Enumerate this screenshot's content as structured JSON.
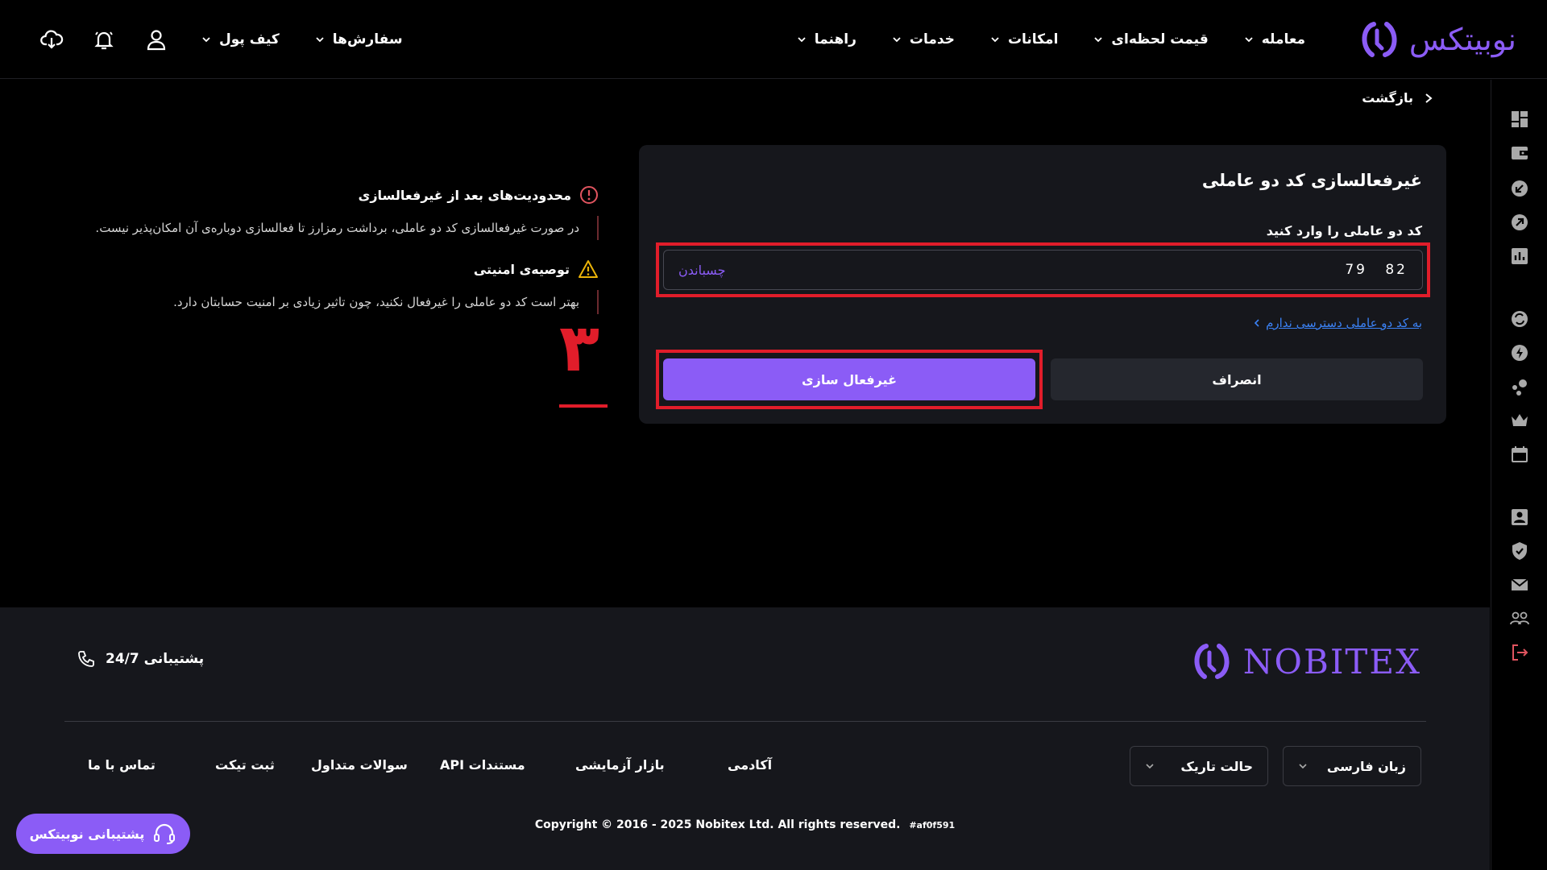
{
  "header": {
    "logo_text": "نوبیتکس",
    "nav": [
      {
        "label": "معامله"
      },
      {
        "label": "قیمت لحظه‌ای"
      },
      {
        "label": "امکانات"
      },
      {
        "label": "خدمات"
      },
      {
        "label": "راهنما"
      }
    ],
    "orders_label": "سفارش‌ها",
    "wallet_label": "کیف پول"
  },
  "back_label": "بازگشت",
  "card": {
    "title": "غیرفعالسازی کد دو عاملی",
    "field_label": "کد دو عاملی را وارد کنید",
    "code_value": "79  82",
    "paste_label": "چسباندن",
    "no_access_link": "به کد دو عاملی دسترسی ندارم",
    "cancel_label": "انصراف",
    "deactivate_label": "غیرفعال سازی"
  },
  "notes": {
    "restriction_title": "محدودیت‌های بعد از غیرفعالسازی",
    "restriction_body": "در صورت غیرفعالسازی کد دو عاملی، برداشت رمزارز تا فعالسازی دوباره‌ی آن امکان‌پذیر نیست.",
    "security_title": "توصیه‌ی امنیتی",
    "security_body": "بهتر است کد دو عاملی را غیرفعال نکنید، چون تاثیر زیادی بر امنیت حسابتان دارد."
  },
  "step_annotation": "۳",
  "footer": {
    "logo_text": "NOBITEX",
    "support_label": "پشتیبانی 24/7",
    "language_label": "زبان فارسی",
    "theme_label": "حالت تاریک",
    "links": [
      {
        "label": "آکادمی"
      },
      {
        "label": "بازار آزمایشی"
      },
      {
        "label": "مستندات API"
      },
      {
        "label": "سوالات متداول"
      },
      {
        "label": "ثبت تیکت"
      },
      {
        "label": "تماس با ما"
      }
    ],
    "copyright": "Copyright © 2016 - 2025 Nobitex Ltd. All rights reserved.",
    "build_hash": "#af0f591"
  },
  "support_button_label": "پشتیبانی نوبیتکس",
  "colors": {
    "accent": "#8b5cf6",
    "highlight": "#e11d2a",
    "link": "#3b82f6",
    "card_bg": "#16171c"
  },
  "icons": {
    "sidebar": [
      "dashboard-icon",
      "wallet-icon",
      "deposit-icon",
      "withdraw-icon",
      "chart-icon",
      "convert-icon",
      "lightning-icon",
      "nodes-icon",
      "crown-icon",
      "calendar-icon",
      "profile-icon",
      "shield-icon",
      "mail-icon",
      "users-icon",
      "logout-icon"
    ]
  }
}
